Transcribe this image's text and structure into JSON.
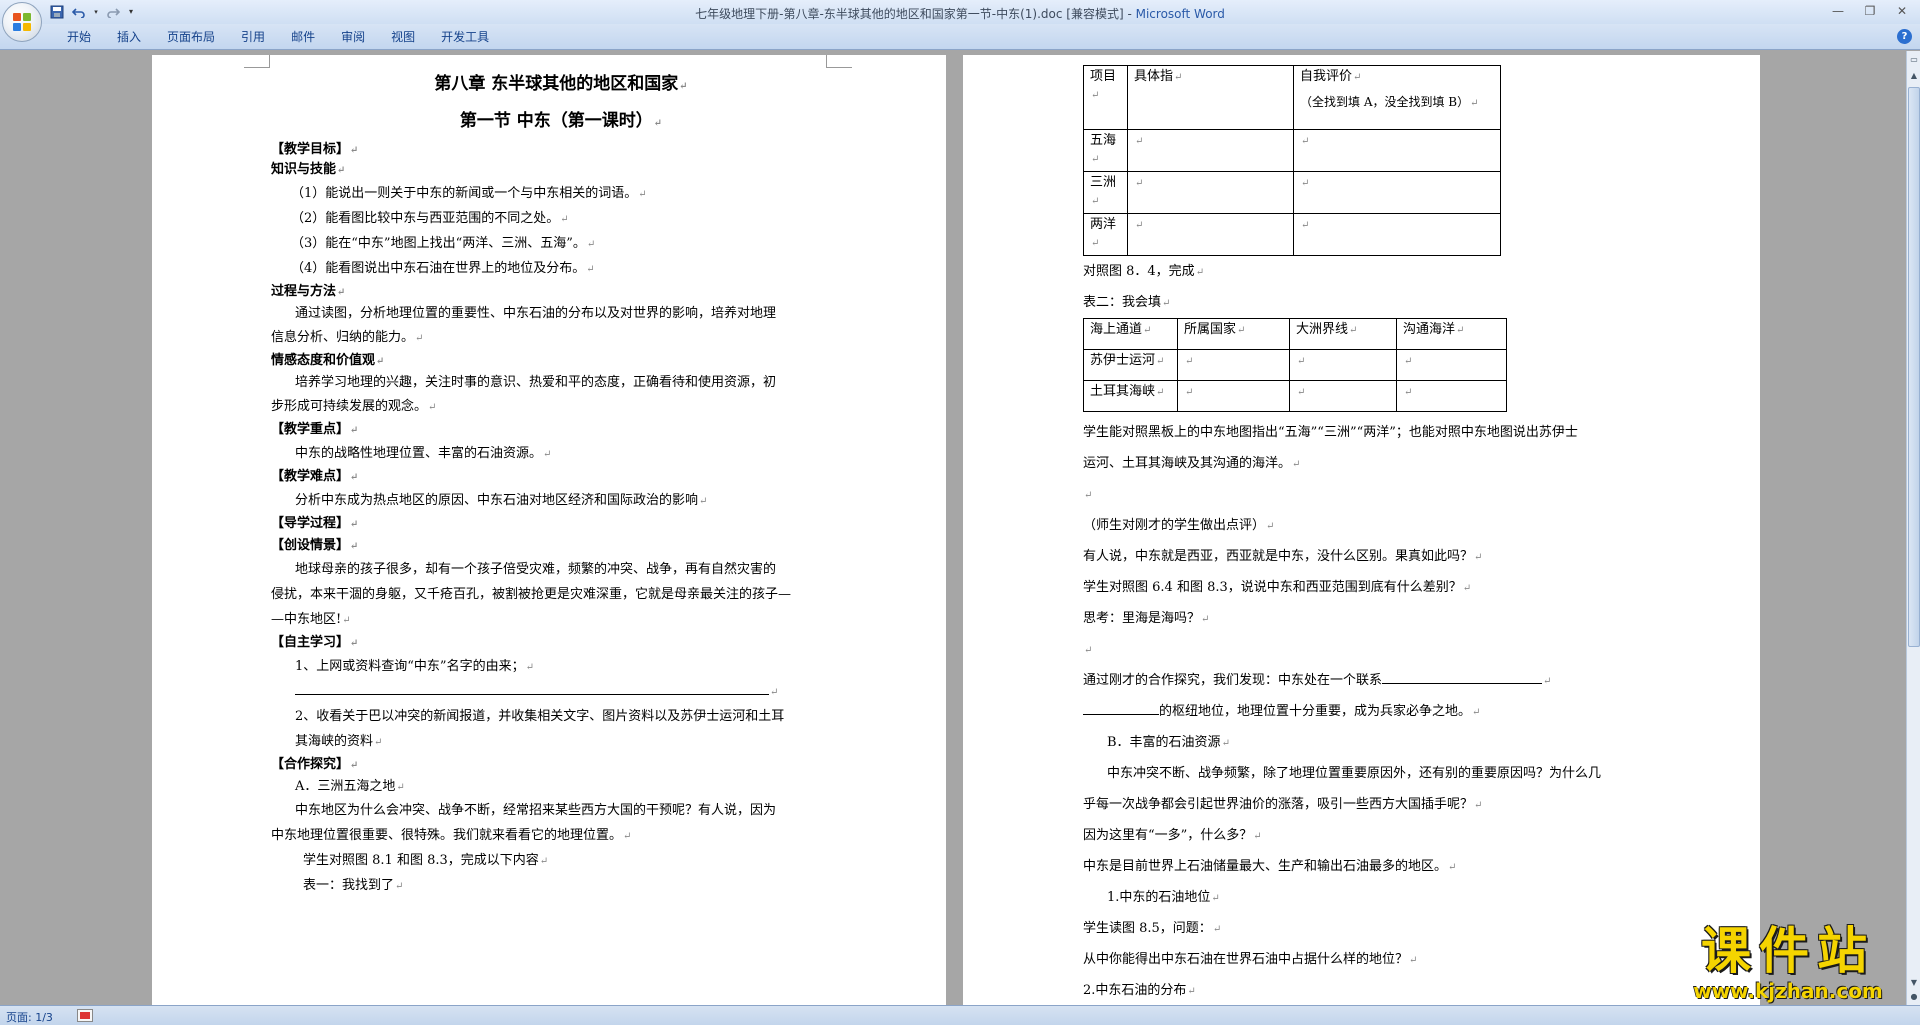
{
  "window": {
    "title": "七年级地理下册-第八章-东半球其他的地区和国家第一节-中东(1).doc [兼容模式] - ",
    "app_name": "Microsoft Word"
  },
  "qat": {
    "save_icon": "save-icon",
    "undo_icon": "undo-icon",
    "redo_icon": "redo-icon",
    "customize_icon": "customize-icon"
  },
  "ribbon": {
    "tabs": [
      "开始",
      "插入",
      "页面布局",
      "引用",
      "邮件",
      "审阅",
      "视图",
      "开发工具"
    ],
    "help_glyph": "?"
  },
  "status": {
    "page_indicator": "页面: 1/3"
  },
  "watermark": {
    "title": "课件站",
    "url": "www.kjzhan.com"
  },
  "page1": {
    "chapter": "第八章        东半球其他的地区和国家",
    "section": "第一节        中东（第一课时）",
    "lines": [
      "【教学目标】",
      "知识与技能",
      "（1）能说出一则关于中东的新闻或一个与中东相关的词语。",
      "（2）能看图比较中东与西亚范围的不同之处。",
      "（3）能在“中东”地图上找出“两洋、三洲、五海”。",
      "（4）能看图说出中东石油在世界上的地位及分布。",
      "过程与方法",
      "通过读图，分析地理位置的重要性、中东石油的分布以及对世界的影响，培养对地理",
      "信息分析、归纳的能力。",
      "情感态度和价值观",
      "培养学习地理的兴趣，关注时事的意识、热爱和平的态度，正确看待和使用资源，初",
      "步形成可持续发展的观念。",
      "【教学重点】",
      "中东的战略性地理位置、丰富的石油资源。",
      "【教学难点】",
      "分析中东成为热点地区的原因、中东石油对地区经济和国际政治的影响",
      "【导学过程】",
      "【创设情景】",
      "地球母亲的孩子很多，却有一个孩子倍受灾难，频繁的冲突、战争，再有自然灾害的",
      "侵扰，本来干涸的身躯，又千疮百孔，被割被抢更是灾难深重，它就是母亲最关注的孩子—",
      "—中东地区!",
      "【自主学习】",
      "1、上网或资料查询“中东”名字的由来；",
      "2、收看关于巴以冲突的新闻报道，并收集相关文字、图片资料以及苏伊士运河和土耳",
      "其海峡的资料",
      "【合作探究】",
      "A．三洲五海之地",
      "中东地区为什么会冲突、战争不断，经常招来某些西方大国的干预呢？有人说，因为",
      "中东地理位置很重要、很特殊。我们就来看看它的地理位置。",
      "学生对照图 8.1 和图 8.3，完成以下内容",
      "表一：我找到了"
    ]
  },
  "page2": {
    "table1": {
      "headers": [
        "项目",
        "具体指",
        "自我评价"
      ],
      "header_note": "（全找到填 A，没全找到填 B）",
      "rows": [
        "五海",
        "三洲",
        "两洋"
      ]
    },
    "line_after_t1": "对照图 8．4，完成",
    "table2_caption": "表二：我会填",
    "table2": {
      "headers": [
        "海上通道",
        "所属国家",
        "大洲界线",
        "沟通海洋"
      ],
      "rows": [
        "苏伊士运河",
        "土耳其海峡"
      ]
    },
    "lines": [
      "学生能对照黑板上的中东地图指出“五海”“三洲”“两洋”；也能对照中东地图说出苏伊士",
      "运河、土耳其海峡及其沟通的海洋。",
      "",
      "（师生对刚才的学生做出点评）",
      "有人说，中东就是西亚，西亚就是中东，没什么区别。果真如此吗？",
      "学生对照图 6.4 和图 8.3，说说中东和西亚范围到底有什么差别？",
      "思考：里海是海吗？",
      "",
      "通过刚才的合作探究，我们发现：中东处在一个联系",
      "的枢纽地位，地理位置十分重要，成为兵家必争之地。",
      "B．丰富的石油资源",
      "中东冲突不断、战争频繁，除了地理位置重要原因外，还有别的重要原因吗？为什么几",
      "乎每一次战争都会引起世界油价的涨落，吸引一些西方大国插手呢？",
      "因为这里有“一多”，什么多？",
      "中东是目前世界上石油储量最大、生产和输出石油最多的地区。",
      "1.中东的石油地位",
      "学生读图 8.5，问题：",
      "从中你能得出中东石油在世界石油中占据什么样的地位？",
      "2.中东石油的分布"
    ]
  }
}
